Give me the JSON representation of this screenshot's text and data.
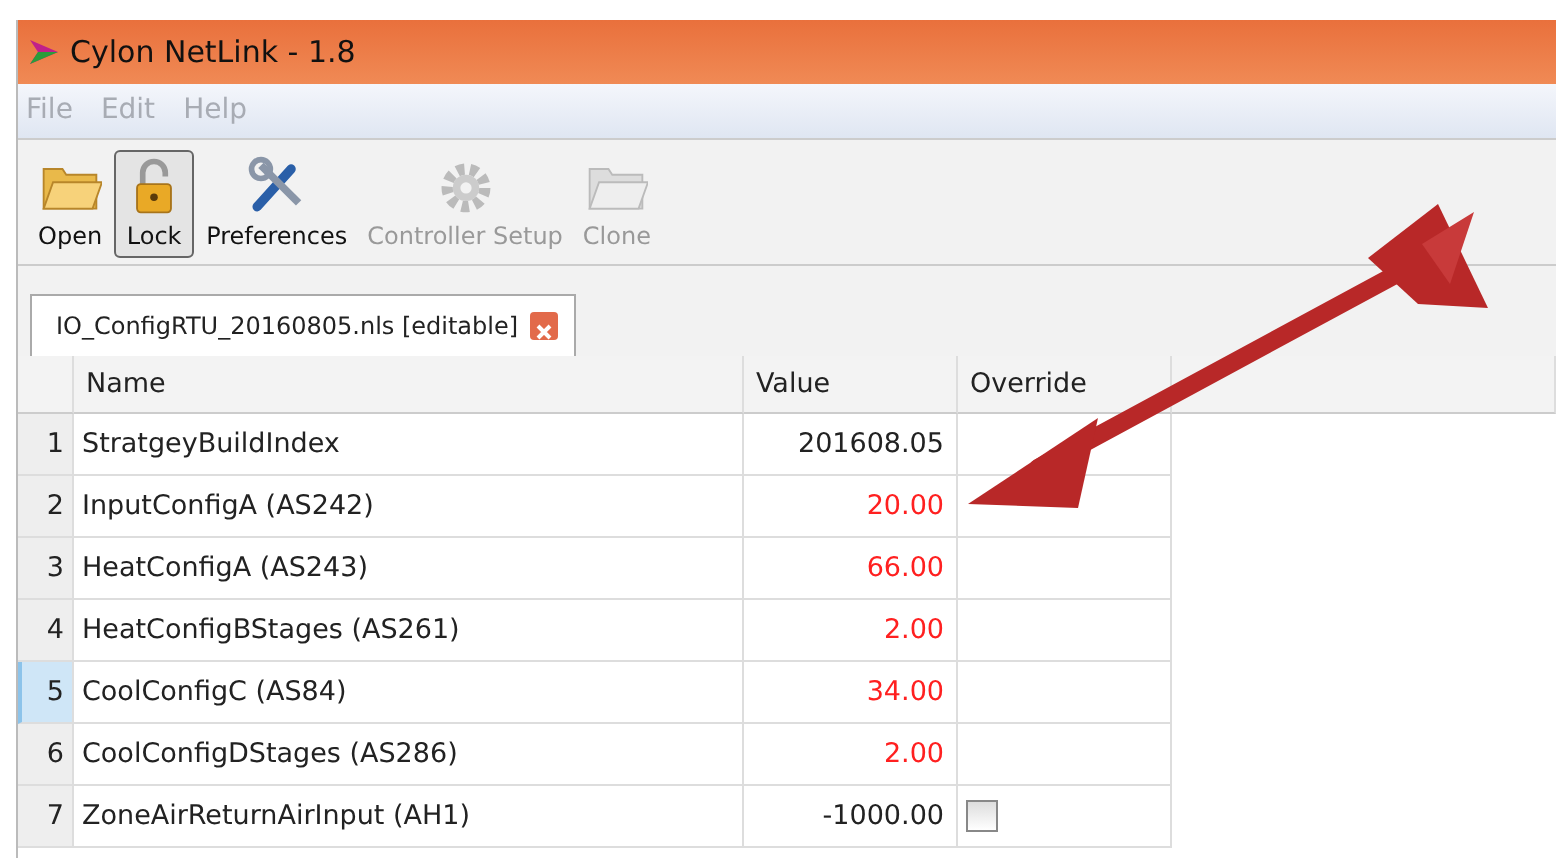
{
  "window": {
    "title": "Cylon NetLink - 1.8"
  },
  "menu": [
    {
      "label": "File",
      "disabled": true
    },
    {
      "label": "Edit",
      "disabled": true
    },
    {
      "label": "Help",
      "disabled": true
    }
  ],
  "toolbar": [
    {
      "label": "Open",
      "kind": "open",
      "disabled": false,
      "pressed": false
    },
    {
      "label": "Lock",
      "kind": "lock",
      "disabled": false,
      "pressed": true
    },
    {
      "label": "Preferences",
      "kind": "tools",
      "disabled": false,
      "pressed": false
    },
    {
      "label": "Controller Setup",
      "kind": "gear",
      "disabled": true,
      "pressed": false
    },
    {
      "label": "Clone",
      "kind": "open",
      "disabled": true,
      "pressed": false
    }
  ],
  "tabs": [
    {
      "label": "IO_ConfigRTU_20160805.nls [editable]",
      "selected": true
    }
  ],
  "table": {
    "columns": [
      "Name",
      "Value",
      "Override"
    ],
    "rows": [
      {
        "number": "1",
        "name": "StratgeyBuildIndex",
        "value": "201608.05",
        "modified": false,
        "selected": false
      },
      {
        "number": "2",
        "name": "InputConfigA (AS242)",
        "value": "20.00",
        "modified": true,
        "selected": false
      },
      {
        "number": "3",
        "name": "HeatConfigA (AS243)",
        "value": "66.00",
        "modified": true,
        "selected": false
      },
      {
        "number": "4",
        "name": "HeatConfigBStages (AS261)",
        "value": "2.00",
        "modified": true,
        "selected": false
      },
      {
        "number": "5",
        "name": "CoolConfigC (AS84)",
        "value": "34.00",
        "modified": true,
        "selected": true
      },
      {
        "number": "6",
        "name": "CoolConfigDStages (AS286)",
        "value": "2.00",
        "modified": true,
        "selected": false
      },
      {
        "number": "7",
        "name": "ZoneAirReturnAirInput (AH1)",
        "value": "-1000.00",
        "modified": false,
        "selected": false,
        "override": {
          "checked": false
        }
      }
    ]
  }
}
